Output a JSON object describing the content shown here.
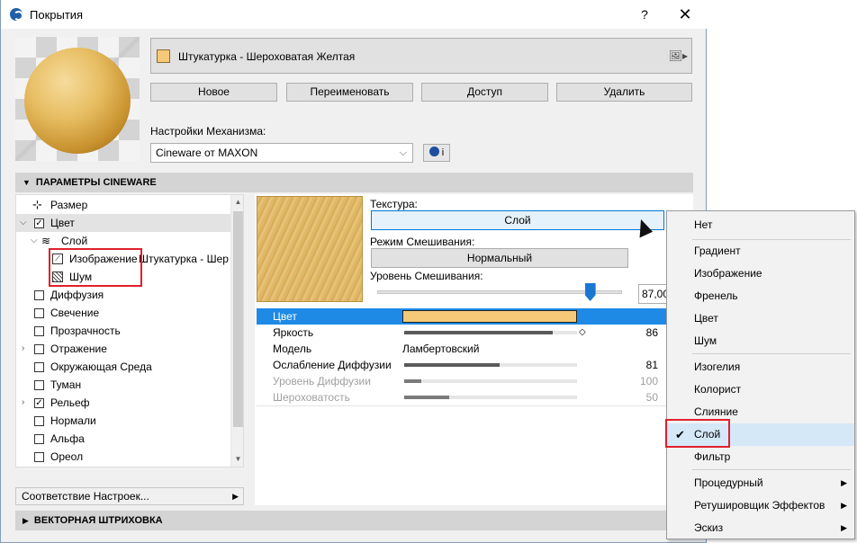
{
  "window": {
    "title": "Покрытия",
    "help_label": "?",
    "close_label": "✕"
  },
  "material": {
    "name": "Штукатурка - Шероховатая Желтая",
    "swatch_color": "#F6C978",
    "menu_icon": "image-icon"
  },
  "buttons": {
    "new": "Новое",
    "rename": "Переименовать",
    "access": "Доступ",
    "delete": "Удалить"
  },
  "engine": {
    "label": "Настройки Механизма:",
    "value": "Cineware от MAXON",
    "info_label": "i"
  },
  "sections": {
    "cineware": "ПАРАМЕТРЫ CINEWARE",
    "vector_hatch": "ВЕКТОРНАЯ ШТРИХОВКА"
  },
  "tree": {
    "items": [
      {
        "label": "Размер",
        "checked": null
      },
      {
        "label": "Цвет",
        "checked": true
      },
      {
        "label": "Слой",
        "checked": null
      },
      {
        "label": "Изображение",
        "suffix": "Штукатурка - Шер",
        "checked": null
      },
      {
        "label": "Шум",
        "checked": null
      },
      {
        "label": "Диффузия",
        "checked": false
      },
      {
        "label": "Свечение",
        "checked": false
      },
      {
        "label": "Прозрачность",
        "checked": false
      },
      {
        "label": "Отражение",
        "checked": false
      },
      {
        "label": "Окружающая Среда",
        "checked": false
      },
      {
        "label": "Туман",
        "checked": false
      },
      {
        "label": "Рельеф",
        "checked": true
      },
      {
        "label": "Нормали",
        "checked": false
      },
      {
        "label": "Альфа",
        "checked": false
      },
      {
        "label": "Ореол",
        "checked": false
      }
    ],
    "match_settings": "Соответствие Настроек..."
  },
  "texture": {
    "label": "Текстура:",
    "value": "Слой",
    "blend_mode_label": "Режим Смешивания:",
    "blend_mode": "Нормальный",
    "blend_level_label": "Уровень Смешивания:",
    "blend_level": "87,00",
    "blend_level_fraction": 0.87
  },
  "properties": [
    {
      "label": "Цвет",
      "value": "",
      "kind": "color",
      "color": "#F6C978"
    },
    {
      "label": "Яркость",
      "value": "86",
      "fraction": 0.86,
      "dim": false
    },
    {
      "label": "Модель",
      "value": "Ламбертовский",
      "kind": "text",
      "dim": false
    },
    {
      "label": "Ослабление Диффузии",
      "value": "81",
      "fraction": 0.55,
      "dim": false
    },
    {
      "label": "Уровень Диффузии",
      "value": "100",
      "fraction": 0.1,
      "dim": true
    },
    {
      "label": "Шероховатость",
      "value": "50",
      "fraction": 0.26,
      "dim": true
    }
  ],
  "context_menu": {
    "items": [
      {
        "label": "Нет",
        "submenu": false,
        "checked": false
      },
      {
        "label": "Градиент",
        "submenu": false,
        "checked": false
      },
      {
        "label": "Изображение",
        "submenu": false,
        "checked": false
      },
      {
        "label": "Френель",
        "submenu": false,
        "checked": false
      },
      {
        "label": "Цвет",
        "submenu": false,
        "checked": false
      },
      {
        "label": "Шум",
        "submenu": false,
        "checked": false
      },
      {
        "label": "Изогелия",
        "submenu": false,
        "checked": false
      },
      {
        "label": "Колорист",
        "submenu": false,
        "checked": false
      },
      {
        "label": "Слияние",
        "submenu": false,
        "checked": false
      },
      {
        "label": "Слой",
        "submenu": false,
        "checked": true
      },
      {
        "label": "Фильтр",
        "submenu": false,
        "checked": false
      },
      {
        "label": "Процедурный",
        "submenu": true,
        "checked": false
      },
      {
        "label": "Ретушировщик Эффектов",
        "submenu": true,
        "checked": false
      },
      {
        "label": "Эскиз",
        "submenu": true,
        "checked": false
      }
    ]
  },
  "colors": {
    "accent": "#1E8AE6",
    "highlight": "#E0202A"
  }
}
